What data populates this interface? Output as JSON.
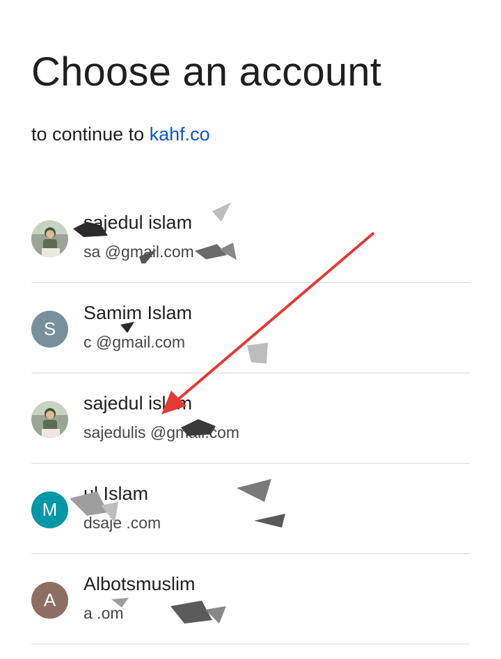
{
  "header": {
    "title": "Choose an account",
    "subtitle_prefix": "to continue to",
    "site_link": "kahf.co"
  },
  "accounts": [
    {
      "name": "sajedul islam",
      "email": "sa          @gmail.com",
      "avatar_type": "photo",
      "avatar_icon": "profile-photo"
    },
    {
      "name": "Samim Islam",
      "email": "c              @gmail.com",
      "avatar_type": "letter",
      "avatar_letter": "S",
      "avatar_color": "#78909c"
    },
    {
      "name": "sajedul islam",
      "email": "sajedulis     @gmail.com",
      "avatar_type": "photo",
      "avatar_icon": "profile-photo"
    },
    {
      "name": "           ul Islam",
      "email": "  dsaje            .com",
      "avatar_type": "letter",
      "avatar_letter": "M",
      "avatar_color": "#0097a7"
    },
    {
      "name": "Albotsmuslim",
      "email": "a                  .om",
      "avatar_type": "letter",
      "avatar_letter": "A",
      "avatar_color": "#8d6e63"
    }
  ],
  "annotation": {
    "arrow_color": "#e53935"
  },
  "colors": {
    "link": "#0b57d0",
    "divider": "#d9d9d9",
    "text_primary": "#1f1f1f",
    "text_secondary": "#444746"
  }
}
